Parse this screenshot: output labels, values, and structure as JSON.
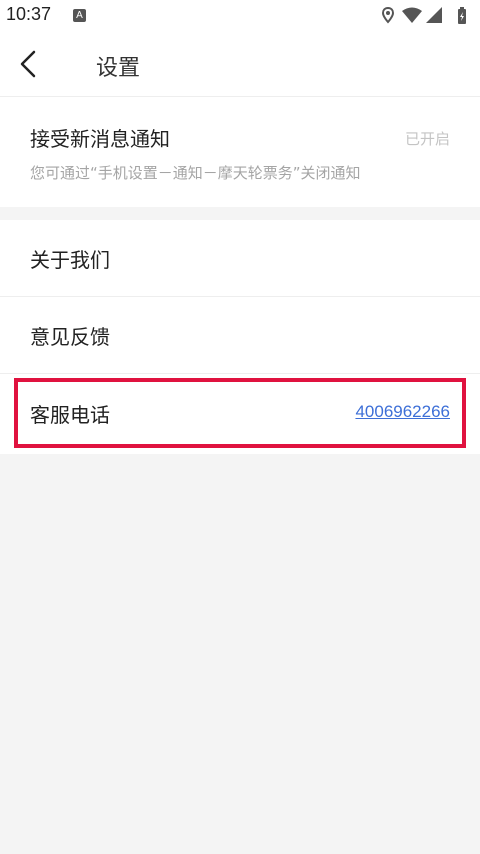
{
  "status_bar": {
    "time": "10:37",
    "notification_letter": "A"
  },
  "nav": {
    "title": "设置"
  },
  "notification_section": {
    "title": "接受新消息通知",
    "status": "已开启",
    "description": "您可通过“手机设置－通知－摩天轮票务”关闭通知"
  },
  "menu": {
    "about": "关于我们",
    "feedback": "意见反馈",
    "service_phone_label": "客服电话",
    "service_phone_number": "4006962266"
  },
  "colors": {
    "highlight": "#e0123f",
    "link": "#3d6fd7"
  }
}
